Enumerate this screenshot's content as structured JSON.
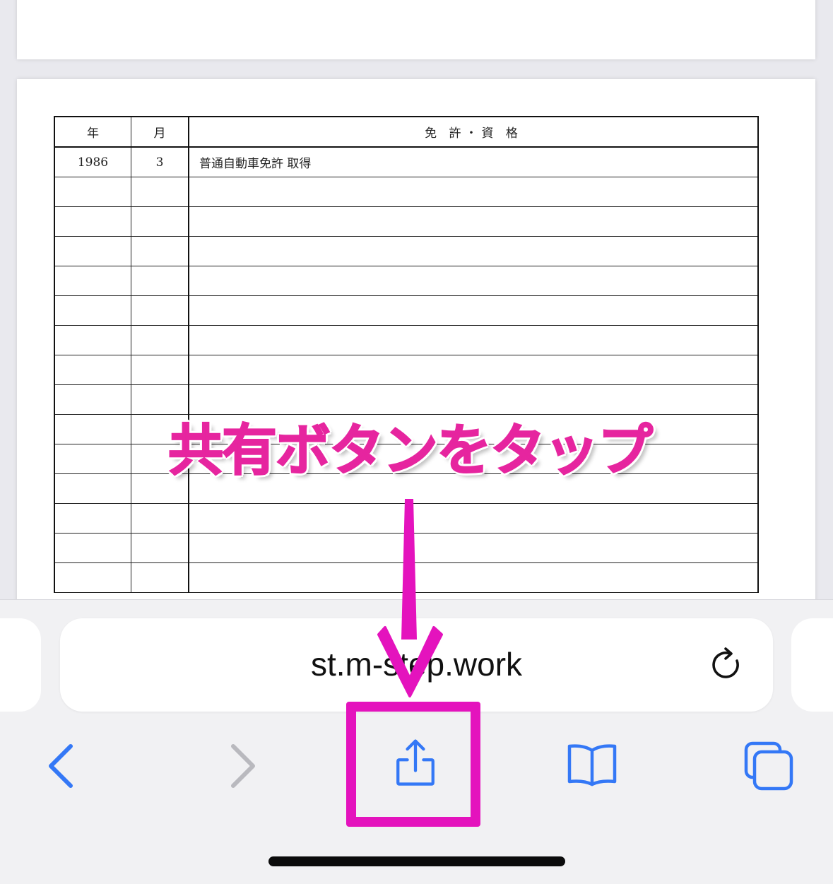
{
  "document": {
    "table": {
      "headers": [
        "年",
        "月",
        "免 許・資 格"
      ],
      "rows": [
        [
          "1986",
          "3",
          "普通自動車免許 取得"
        ],
        [
          "",
          "",
          ""
        ],
        [
          "",
          "",
          ""
        ],
        [
          "",
          "",
          ""
        ],
        [
          "",
          "",
          ""
        ],
        [
          "",
          "",
          ""
        ],
        [
          "",
          "",
          ""
        ],
        [
          "",
          "",
          ""
        ],
        [
          "",
          "",
          ""
        ],
        [
          "",
          "",
          ""
        ],
        [
          "",
          "",
          ""
        ],
        [
          "",
          "",
          ""
        ],
        [
          "",
          "",
          ""
        ],
        [
          "",
          "",
          ""
        ],
        [
          "",
          "",
          ""
        ]
      ]
    }
  },
  "annotation": {
    "caption": "共有ボタンをタップ",
    "color": "#e413bd"
  },
  "browser": {
    "url": "st.m-step.work",
    "accent_color": "#3478f6",
    "toolbar": [
      {
        "name": "back",
        "icon": "chevron-left-icon",
        "enabled": true
      },
      {
        "name": "forward",
        "icon": "chevron-right-icon",
        "enabled": false
      },
      {
        "name": "share",
        "icon": "share-icon",
        "enabled": true
      },
      {
        "name": "bookmarks",
        "icon": "book-icon",
        "enabled": true
      },
      {
        "name": "tabs",
        "icon": "tabs-icon",
        "enabled": true
      }
    ],
    "reload_icon": "reload-icon"
  }
}
